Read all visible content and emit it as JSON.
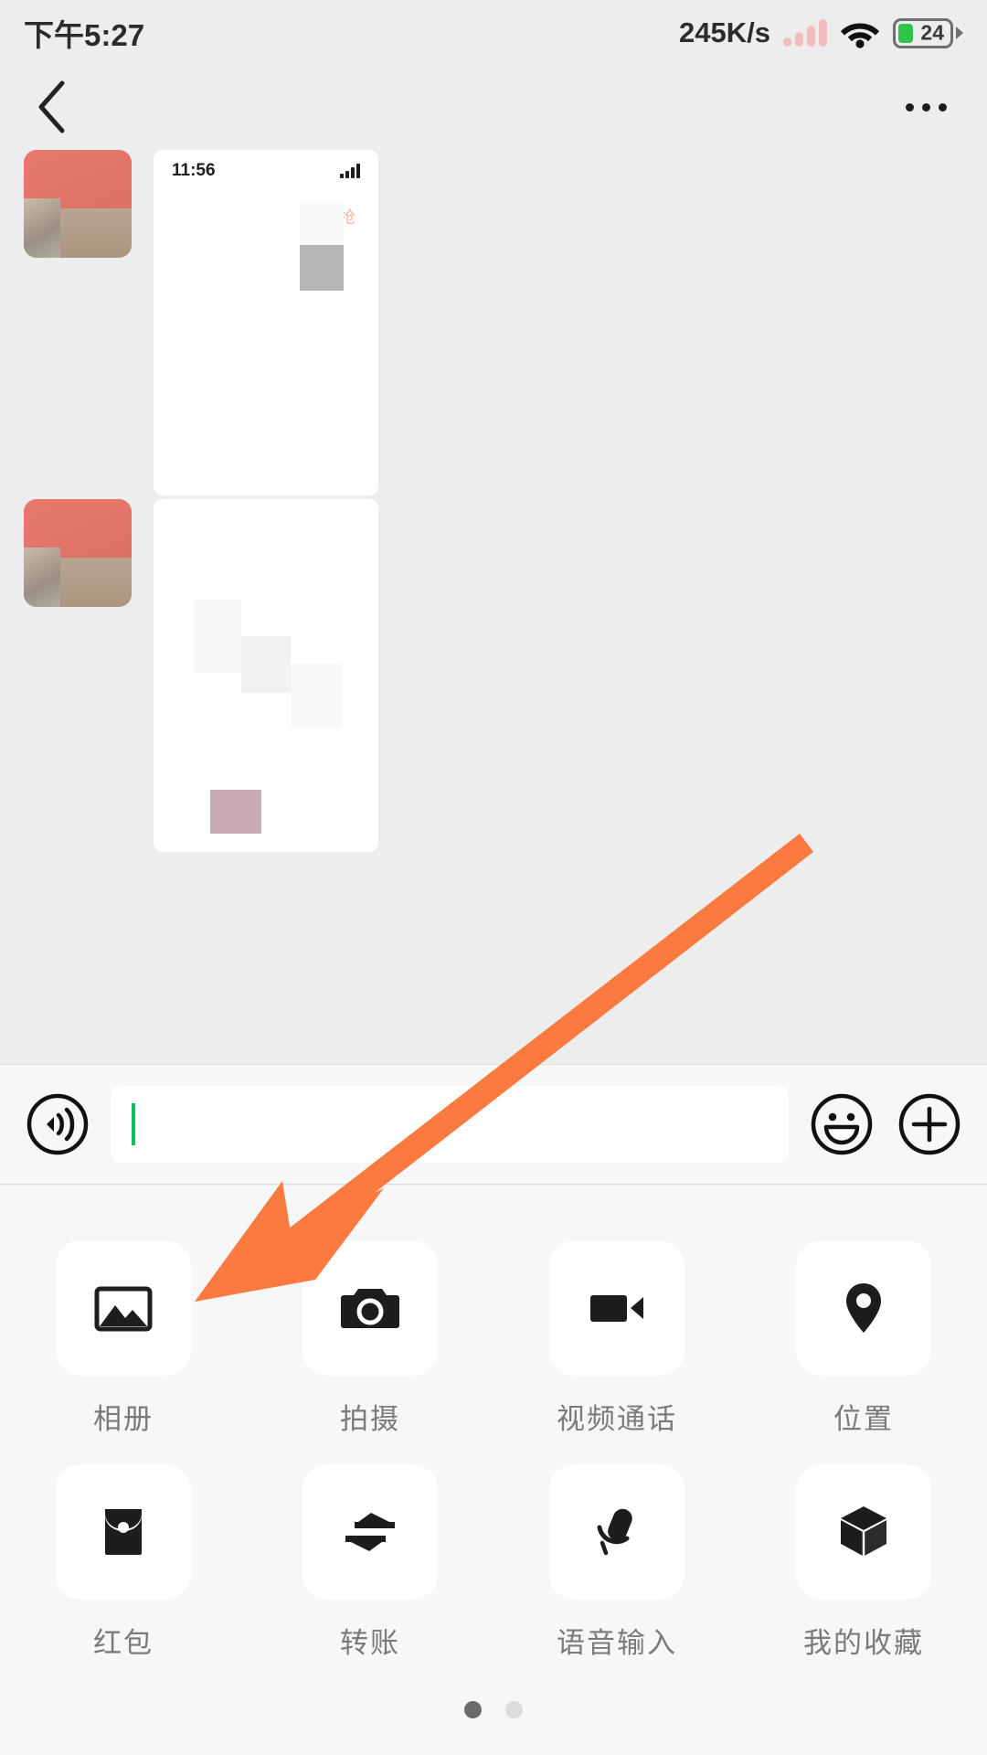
{
  "status_bar": {
    "time": "下午5:27",
    "network_speed": "245K/s",
    "battery_level": "24",
    "signal_icon": "signal-bars-icon",
    "wifi_icon": "wifi-icon",
    "battery_icon": "battery-icon",
    "colors": {
      "battery_fill": "#2fc54b",
      "signal_bars": "#f3bdbd",
      "text": "#2b2b2b"
    }
  },
  "nav_bar": {
    "back_icon": "chevron-left-icon",
    "more_icon": "more-options-icon"
  },
  "chat": {
    "messages": [
      {
        "sender_avatar": "contact-avatar",
        "attachment_type": "screenshot-image",
        "screenshot_time": "11:56",
        "screenshot_tag": "已抢"
      },
      {
        "sender_avatar": "contact-avatar",
        "attachment_type": "screenshot-image",
        "screenshot_time": "",
        "screenshot_tag": ""
      }
    ]
  },
  "input_bar": {
    "voice_icon": "voice-input-icon",
    "text_value": "",
    "placeholder": "",
    "emoji_icon": "emoji-smiley-icon",
    "plus_icon": "plus-circle-icon",
    "caret_color": "#07c160"
  },
  "panel": {
    "items": [
      {
        "label": "相册",
        "icon": "image-icon"
      },
      {
        "label": "拍摄",
        "icon": "camera-icon"
      },
      {
        "label": "视频通话",
        "icon": "video-call-icon"
      },
      {
        "label": "位置",
        "icon": "location-pin-icon"
      },
      {
        "label": "红包",
        "icon": "red-packet-icon"
      },
      {
        "label": "转账",
        "icon": "transfer-arrows-icon"
      },
      {
        "label": "语音输入",
        "icon": "microphone-icon"
      },
      {
        "label": "我的收藏",
        "icon": "cube-favorites-icon"
      }
    ],
    "page_dots": {
      "total": 2,
      "active_index": 0
    }
  },
  "annotation": {
    "arrow_icon": "pointer-arrow-icon",
    "arrow_color": "#fb7a3f",
    "points_to": "相册"
  }
}
